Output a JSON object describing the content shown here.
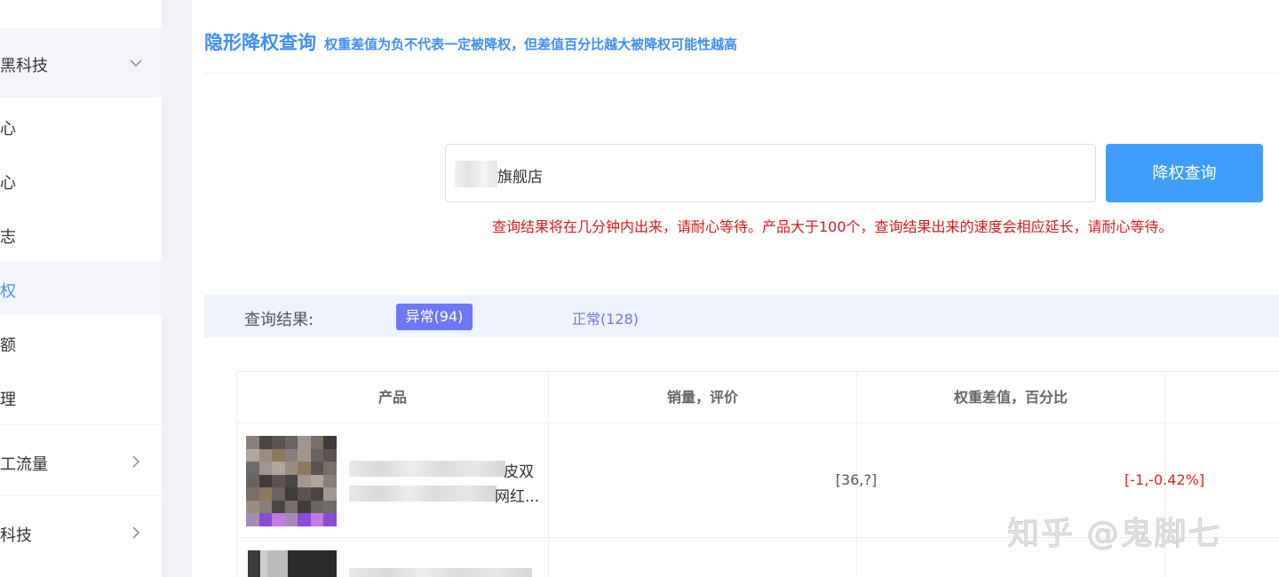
{
  "sidebar": {
    "items": [
      {
        "label": "黑科技",
        "chevron": "down"
      },
      {
        "label": "心"
      },
      {
        "label": "心"
      },
      {
        "label": "志"
      },
      {
        "label": "权",
        "active": true
      },
      {
        "label": "额"
      },
      {
        "label": "理"
      },
      {
        "label": "工流量",
        "chevron": "right"
      },
      {
        "label": "科技",
        "chevron": "right"
      }
    ]
  },
  "header": {
    "title": "隐形降权查询",
    "note": "权重差值为负不代表一定被降权，但差值百分比越大被降权可能性越高"
  },
  "search": {
    "value": "旗舰店",
    "button_label": "降权查询",
    "hint": "查询结果将在几分钟内出来，请耐心等待。产品大于100个，查询结果出来的速度会相应延长，请耐心等待。"
  },
  "results": {
    "label": "查询结果:",
    "tab_abnormal": "异常(94)",
    "tab_normal": "正常(128)"
  },
  "table": {
    "columns": [
      "产品",
      "销量，评价",
      "权重差值，百分比"
    ],
    "rows": [
      {
        "product_text_1": "皮双",
        "product_text_2": "网红...",
        "sales": "[36,?]",
        "weight": "[-1,-0.42%]"
      }
    ]
  },
  "watermark": "知乎 @鬼脚七",
  "colors": {
    "accent": "#409eff",
    "tab": "#6e78f7",
    "warning": "#d7191f"
  }
}
